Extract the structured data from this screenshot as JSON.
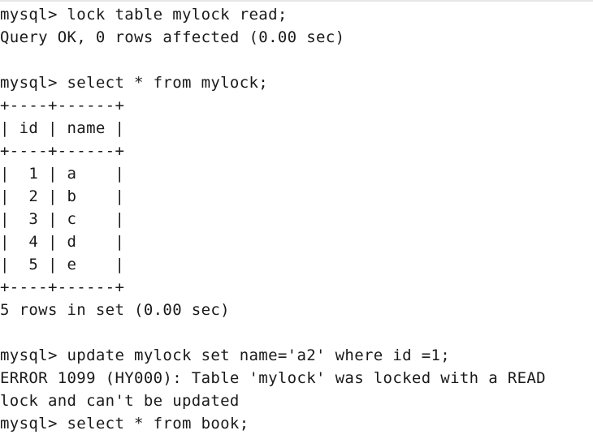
{
  "terminal": {
    "lines": [
      "mysql> lock table mylock read;",
      "Query OK, 0 rows affected (0.00 sec)",
      "",
      "mysql> select * from mylock;",
      "+----+------+",
      "| id | name |",
      "+----+------+",
      "|  1 | a    |",
      "|  2 | b    |",
      "|  3 | c    |",
      "|  4 | d    |",
      "|  5 | e    |",
      "+----+------+",
      "5 rows in set (0.00 sec)",
      "",
      "mysql> update mylock set name='a2' where id =1;",
      "ERROR 1099 (HY000): Table 'mylock' was locked with a READ",
      "lock and can't be updated",
      "mysql> select * from book;"
    ]
  }
}
